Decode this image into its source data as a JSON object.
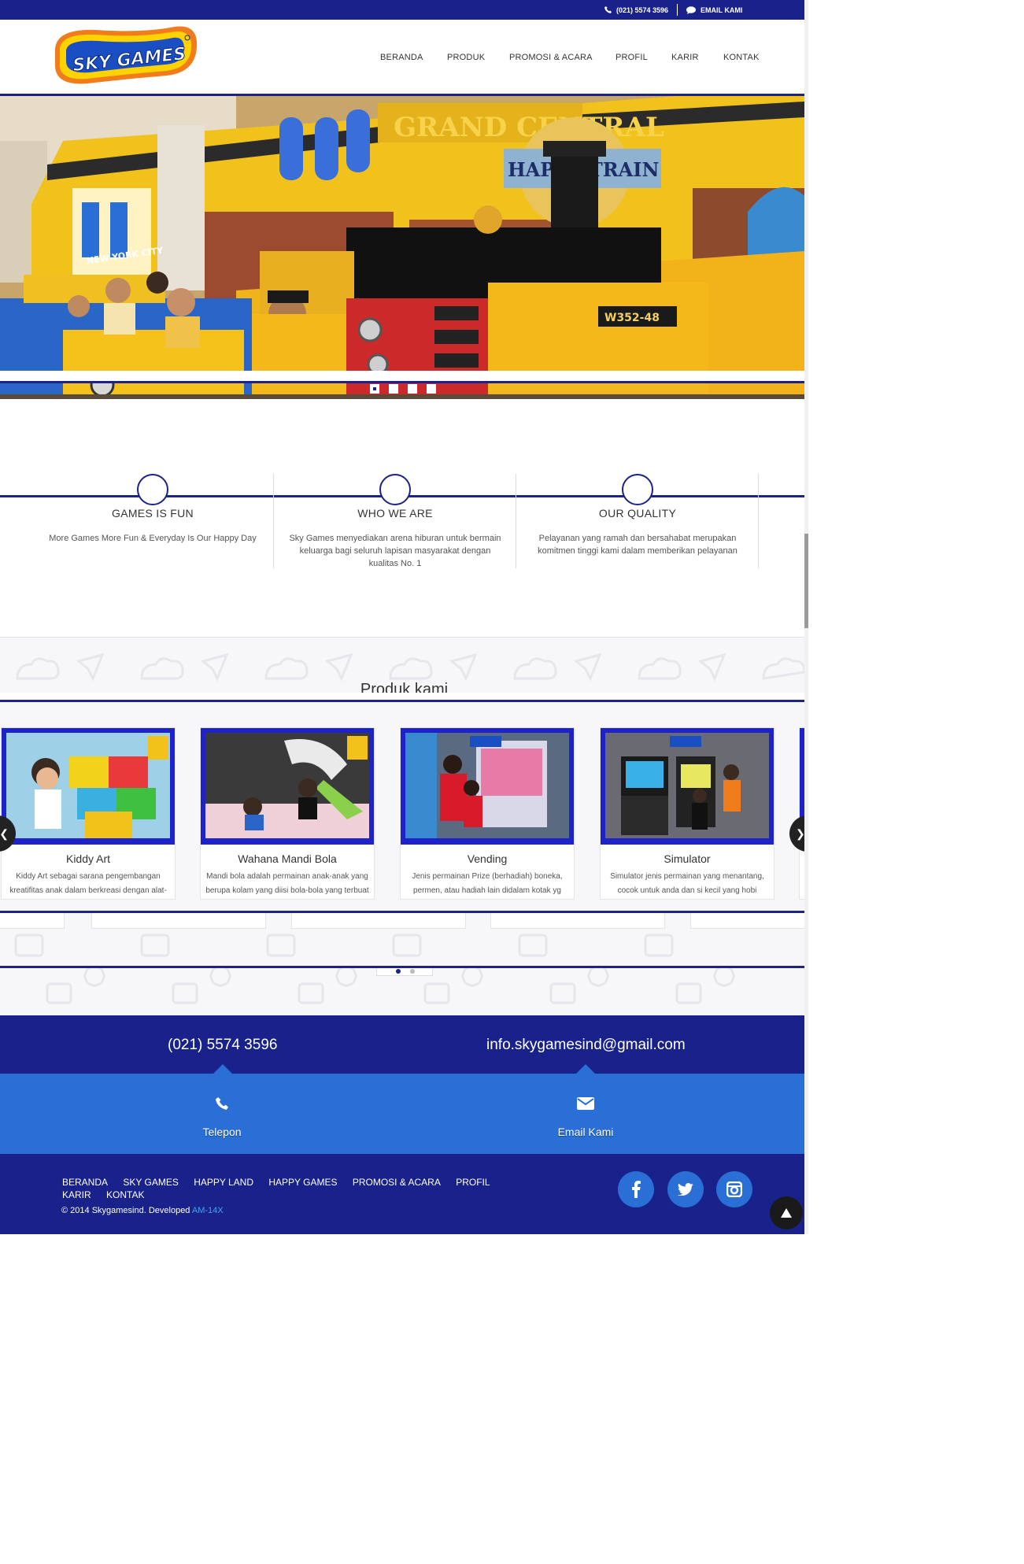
{
  "topbar": {
    "phone": "(021) 5574 3596",
    "email_label": "EMAIL KAMI",
    "icons": [
      "phone-icon",
      "chat-bubble-icon"
    ],
    "bg_color": "#19228a"
  },
  "brand": {
    "logo_text": "SKY GAMES"
  },
  "nav": {
    "items": [
      {
        "label": "BERANDA"
      },
      {
        "label": "PRODUK"
      },
      {
        "label": "PROMOSI & ACARA"
      },
      {
        "label": "PROFIL"
      },
      {
        "label": "KARIR"
      },
      {
        "label": "KONTAK"
      }
    ]
  },
  "hero": {
    "slide_count": 4,
    "active_slide": 1,
    "scene_signs": [
      "GRAND CENTRAL",
      "HAPPY TRAIN",
      "NEW YORK CITY",
      "W352-48"
    ]
  },
  "features": [
    {
      "title": "GAMES IS FUN",
      "text": "More Games More Fun & Everyday Is Our Happy Day"
    },
    {
      "title": "WHO WE ARE",
      "text": "Sky Games menyediakan arena hiburan untuk bermain keluarga bagi seluruh lapisan masyarakat dengan kualitas No. 1"
    },
    {
      "title": "OUR QUALITY",
      "text": "Pelayanan yang ramah dan bersahabat merupakan komitmen tinggi kami dalam memberikan pelayanan"
    }
  ],
  "products": {
    "heading": "Produk kami",
    "items": [
      {
        "name": "Kiddy Art",
        "desc": "Kiddy Art sebagai sarana pengembangan kreatifitas anak dalam berkreasi dengan alat-alat artistik"
      },
      {
        "name": "Wahana Mandi Bola",
        "desc": "Mandi bola adalah permainan anak-anak yang berupa kolam yang diisi bola-bola yang terbuat dari"
      },
      {
        "name": "Vending",
        "desc": "Jenis permainan Prize (berhadiah) boneka, permen, atau hadiah lain didalam kotak yg kemudian"
      },
      {
        "name": "Simulator",
        "desc": "Simulator jenis permainan yang menantang, cocok untuk anda dan si kecil yang hobi berpetualang"
      }
    ],
    "prev_icon": "chevron-left-icon",
    "next_icon": "chevron-right-icon",
    "page_count": 2,
    "active_page": 1
  },
  "contact": {
    "phone": "(021) 5574 3596",
    "email": "info.skygamesind@gmail.com",
    "call_label": "Telepon",
    "mail_label": "Email Kami"
  },
  "footer": {
    "links": [
      "BERANDA",
      "SKY GAMES",
      "HAPPY LAND",
      "HAPPY GAMES",
      "PROMOSI & ACARA",
      "PROFIL",
      "KARIR",
      "KONTAK"
    ],
    "copyright": "© 2014 Skygamesind. Developed",
    "developer": "AM-14X",
    "social_icons": [
      "facebook-icon",
      "twitter-icon",
      "instagram-icon"
    ]
  },
  "colors": {
    "navy": "#19228a",
    "blue": "#2a6fd6",
    "accent_line": "#1d2386",
    "yellow": "#f5c400"
  }
}
